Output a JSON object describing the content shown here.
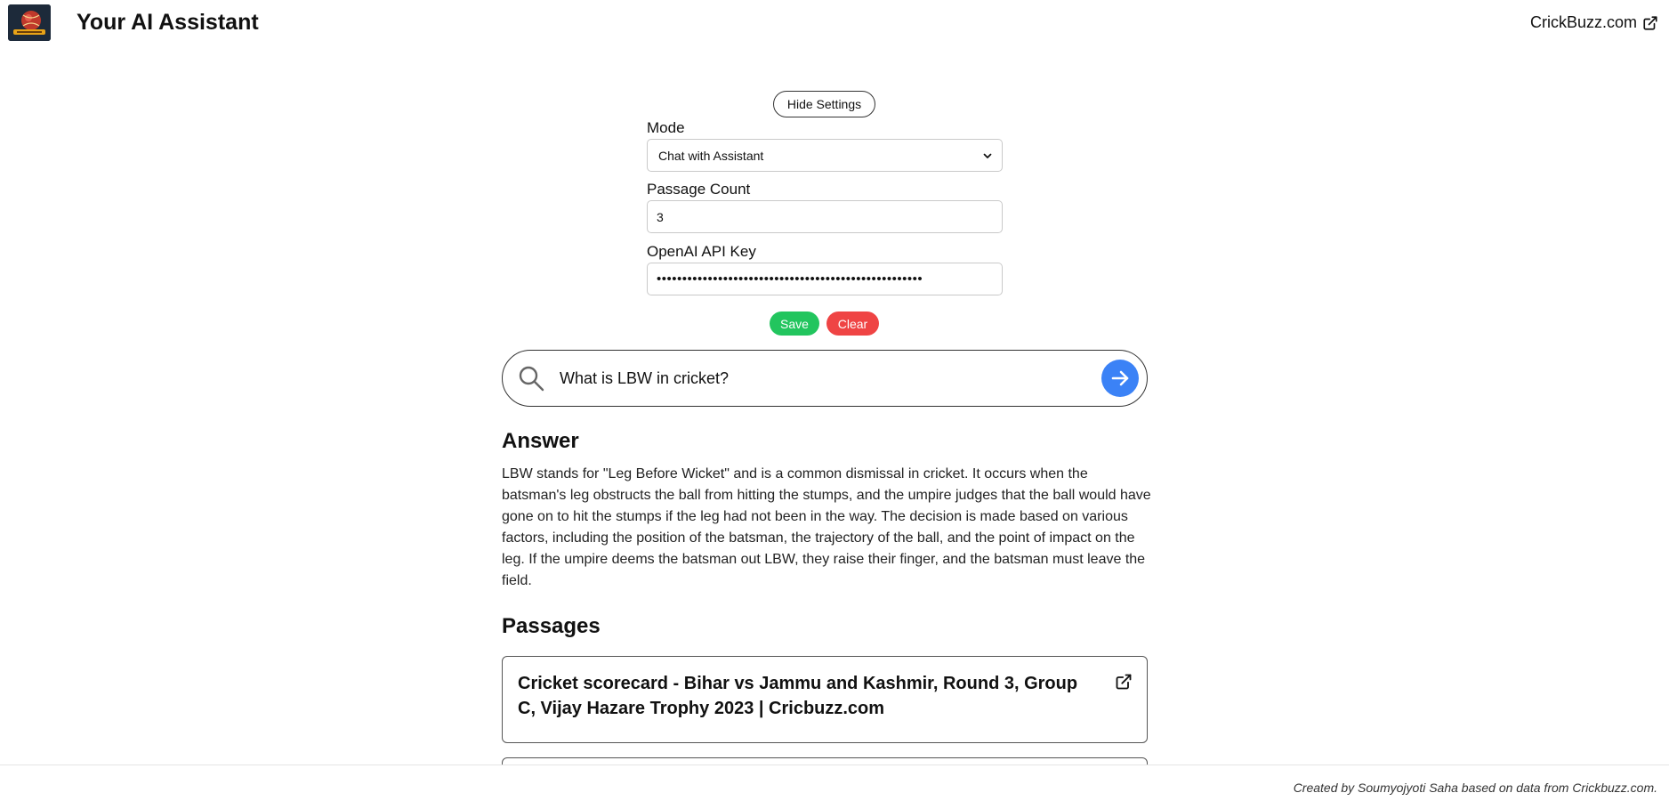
{
  "header": {
    "title": "Your AI Assistant",
    "logo_icon": "cricket-ball-logo-icon",
    "link_label": "CrickBuzz.com",
    "link_icon": "external-link-icon"
  },
  "settings": {
    "toggle_label": "Hide Settings",
    "mode_label": "Mode",
    "mode_value": "Chat with Assistant",
    "passage_count_label": "Passage Count",
    "passage_count_value": "3",
    "api_key_label": "OpenAI API Key",
    "api_key_masked": "••••••••••••••••••••••••••••••••••••••••••••••••••••",
    "save_label": "Save",
    "clear_label": "Clear",
    "save_color": "#22c55e",
    "clear_color": "#ef4444"
  },
  "search": {
    "query": "What is LBW in cricket?",
    "icon": "search-icon",
    "submit_icon": "arrow-right-icon",
    "submit_color": "#3b82f6"
  },
  "answer": {
    "heading": "Answer",
    "text": "LBW stands for \"Leg Before Wicket\" and is a common dismissal in cricket. It occurs when the batsman's leg obstructs the ball from hitting the stumps, and the umpire judges that the ball would have gone on to hit the stumps if the leg had not been in the way. The decision is made based on various factors, including the position of the batsman, the trajectory of the ball, and the point of impact on the leg. If the umpire deems the batsman out LBW, they raise their finger, and the batsman must leave the field."
  },
  "passages": {
    "heading": "Passages",
    "items": [
      {
        "title": "Cricket scorecard - Bihar vs Jammu and Kashmir, Round 3, Group C, Vijay Hazare Trophy 2023 | Cricbuzz.com",
        "icon": "external-link-icon"
      }
    ]
  },
  "footer": {
    "credit": "Created by Soumyojyoti Saha based on data from Crickbuzz.com."
  }
}
